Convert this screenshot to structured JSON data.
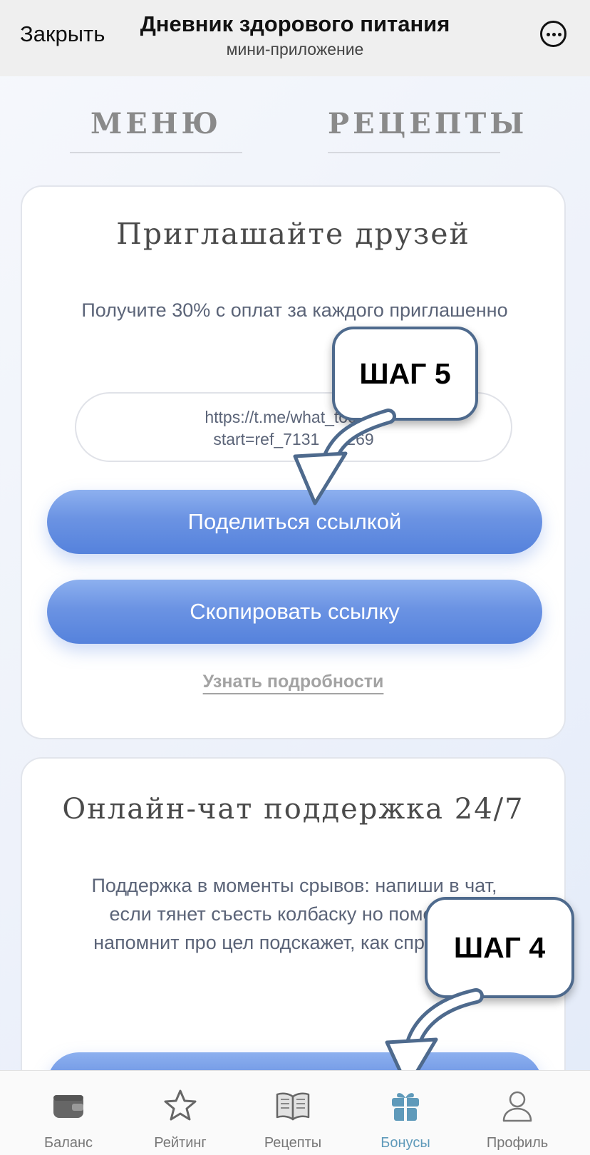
{
  "header": {
    "close_label": "Закрыть",
    "title": "Дневник здорового питания",
    "subtitle": "мини-приложение",
    "more_icon": "ellipsis-circle-icon"
  },
  "tabs": [
    {
      "label": "МЕНЮ"
    },
    {
      "label": "РЕЦЕПТЫ"
    }
  ],
  "invite_card": {
    "title": "Приглашайте друзей",
    "description": "Получите 30% с оплат за каждого приглашенно",
    "link_line1": "https://t.me/what_tocook",
    "link_line2": "start=ref_7131",
    "link_line2_tail": "269",
    "share_button": "Поделиться ссылкой",
    "copy_button": "Скопировать ссылку",
    "details_link": "Узнать подробности"
  },
  "support_card": {
    "title": "Онлайн-чат поддержка 24/7",
    "description": "Поддержка в моменты срывов: напиши в чат, если тянет съесть колбаску но помощник напомнит про цел подскажет, как справиться"
  },
  "callouts": [
    {
      "label": "ШАГ 5"
    },
    {
      "label": "ШАГ 4"
    }
  ],
  "bottom_nav": {
    "active": "Бонусы",
    "active_color": "#5f9aba",
    "items": [
      {
        "label": "Баланс",
        "icon": "wallet-icon"
      },
      {
        "label": "Рейтинг",
        "icon": "star-icon"
      },
      {
        "label": "Рецепты",
        "icon": "book-icon"
      },
      {
        "label": "Бонусы",
        "icon": "gift-icon"
      },
      {
        "label": "Профиль",
        "icon": "person-icon"
      }
    ]
  }
}
